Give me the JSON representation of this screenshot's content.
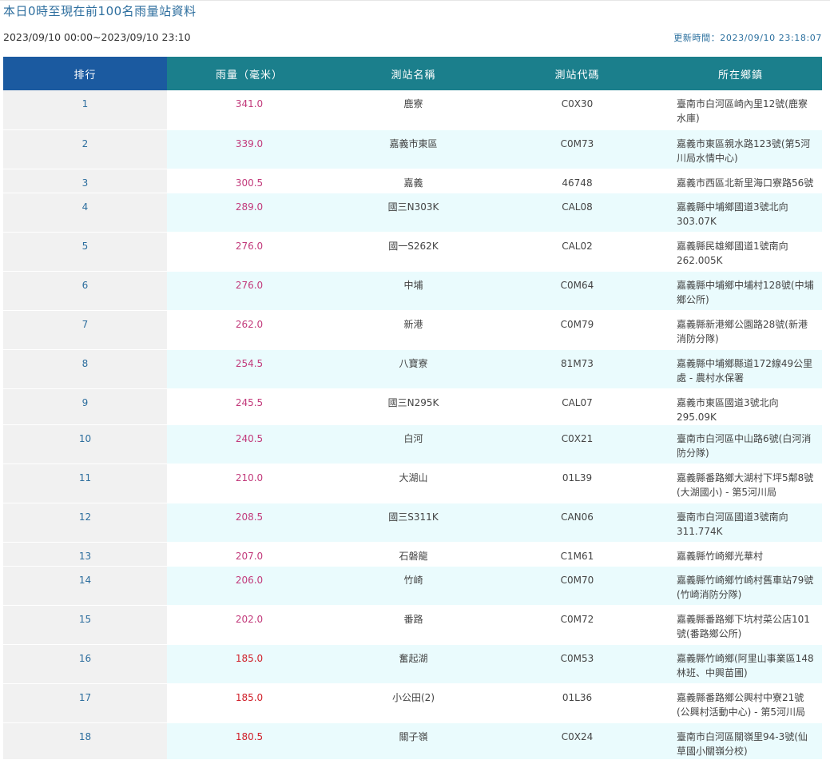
{
  "page": {
    "title": "本日0時至現在前100名雨量站資料",
    "range": "2023/09/10 00:00~2023/09/10 23:10",
    "updated": "更新時間：2023/09/10 23:18:07"
  },
  "table": {
    "headers": [
      "排行",
      "雨量（毫米）",
      "測站名稱",
      "測站代碼",
      "所在鄉鎮"
    ],
    "rows": [
      {
        "rank": "1",
        "rain": "341.0",
        "name": "鹿寮",
        "code": "C0X30",
        "town": "臺南市白河區崎內里12號(鹿寮水庫)"
      },
      {
        "rank": "2",
        "rain": "339.0",
        "name": "嘉義市東區",
        "code": "C0M73",
        "town": "嘉義市東區親水路123號(第5河川局水情中心)"
      },
      {
        "rank": "3",
        "rain": "300.5",
        "name": "嘉義",
        "code": "46748",
        "town": "嘉義市西區北新里海口寮路56號"
      },
      {
        "rank": "4",
        "rain": "289.0",
        "name": "國三N303K",
        "code": "CAL08",
        "town": "嘉義縣中埔鄉國道3號北向303.07K"
      },
      {
        "rank": "5",
        "rain": "276.0",
        "name": "國一S262K",
        "code": "CAL02",
        "town": "嘉義縣民雄鄉國道1號南向262.005K"
      },
      {
        "rank": "6",
        "rain": "276.0",
        "name": "中埔",
        "code": "C0M64",
        "town": "嘉義縣中埔鄉中埔村128號(中埔鄉公所)"
      },
      {
        "rank": "7",
        "rain": "262.0",
        "name": "新港",
        "code": "C0M79",
        "town": "嘉義縣新港鄉公園路28號(新港消防分隊)"
      },
      {
        "rank": "8",
        "rain": "254.5",
        "name": "八寶寮",
        "code": "81M73",
        "town": "嘉義縣中埔鄉縣道172線49公里處 - 農村水保署"
      },
      {
        "rank": "9",
        "rain": "245.5",
        "name": "國三N295K",
        "code": "CAL07",
        "town": "嘉義市東區國道3號北向295.09K"
      },
      {
        "rank": "10",
        "rain": "240.5",
        "name": "白河",
        "code": "C0X21",
        "town": "臺南市白河區中山路6號(白河消防分隊)"
      },
      {
        "rank": "11",
        "rain": "210.0",
        "name": "大湖山",
        "code": "01L39",
        "town": "嘉義縣番路鄉大湖村下坪5鄰8號(大湖國小) - 第5河川局"
      },
      {
        "rank": "12",
        "rain": "208.5",
        "name": "國三S311K",
        "code": "CAN06",
        "town": "臺南市白河區國道3號南向311.774K"
      },
      {
        "rank": "13",
        "rain": "207.0",
        "name": "石磐龍",
        "code": "C1M61",
        "town": "嘉義縣竹崎鄉光華村"
      },
      {
        "rank": "14",
        "rain": "206.0",
        "name": "竹崎",
        "code": "C0M70",
        "town": "嘉義縣竹崎鄉竹崎村舊車站79號(竹崎消防分隊)"
      },
      {
        "rank": "15",
        "rain": "202.0",
        "name": "番路",
        "code": "C0M72",
        "town": "嘉義縣番路鄉下坑村菜公店101號(番路鄉公所)"
      },
      {
        "rank": "16",
        "rain": "185.0",
        "name": "奮起湖",
        "code": "C0M53",
        "town": "嘉義縣竹崎鄉(阿里山事業區148林班、中興苗圃)"
      },
      {
        "rank": "17",
        "rain": "185.0",
        "name": "小公田(2)",
        "code": "01L36",
        "town": "嘉義縣番路鄉公興村中寮21號(公興村活動中心) - 第5河川局"
      },
      {
        "rank": "18",
        "rain": "180.5",
        "name": "關子嶺",
        "code": "C0X24",
        "town": "臺南市白河區關嶺里94-3號(仙草國小關嶺分校)"
      }
    ],
    "row_heights": [],
    "high_color": "#c23a7b",
    "low_color": "#d0202a"
  }
}
